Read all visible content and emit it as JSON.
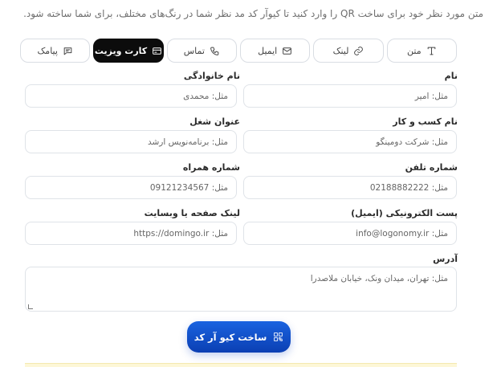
{
  "intro_text": "متن مورد نظر خود برای ساخت QR را وارد کنید تا کیوآر کد مد نظر شما در رنگ‌های مختلف، برای شما ساخته شود.",
  "tabs": [
    {
      "label": "متن",
      "icon": "text-icon",
      "active": false
    },
    {
      "label": "لینک",
      "icon": "link-icon",
      "active": false
    },
    {
      "label": "ایمیل",
      "icon": "mail-icon",
      "active": false
    },
    {
      "label": "تماس",
      "icon": "phone-icon",
      "active": false
    },
    {
      "label": "کارت ویزیت",
      "icon": "card-icon",
      "active": true
    },
    {
      "label": "پیامک",
      "icon": "sms-icon",
      "active": false
    }
  ],
  "form": {
    "first_name": {
      "label": "نام",
      "placeholder": "مثل: امیر"
    },
    "last_name": {
      "label": "نام خانوادگی",
      "placeholder": "مثل: محمدی"
    },
    "business": {
      "label": "نام کسب و کار",
      "placeholder": "مثل: شرکت دومینگو"
    },
    "job_title": {
      "label": "عنوان شغل",
      "placeholder": "مثل: برنامه‌نویس ارشد"
    },
    "phone": {
      "label": "شماره تلفن",
      "placeholder": "مثل: 02188882222"
    },
    "mobile": {
      "label": "شماره همراه",
      "placeholder": "مثل: 09121234567"
    },
    "email": {
      "label": "پست الکترونیکی (ایمیل)",
      "placeholder": "مثل: info@logonomy.ir"
    },
    "website": {
      "label": "لینک صفحه یا وبسایت",
      "placeholder": "مثل: https://domingo.ir"
    },
    "address": {
      "label": "آدرس",
      "placeholder": "مثل: تهران، میدان ونک، خیابان ملاصدرا"
    }
  },
  "submit_label": "ساخت کیو آر کد",
  "colors": {
    "accent": "#0b3fb3",
    "active_tab": "#0c0c0c"
  }
}
